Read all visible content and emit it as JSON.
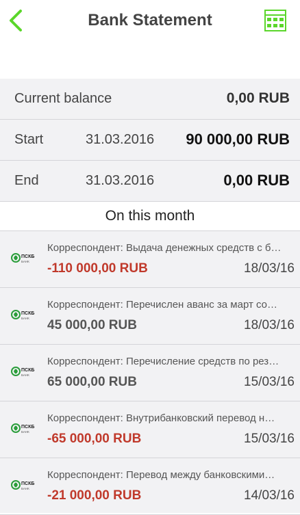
{
  "header": {
    "title": "Bank Statement"
  },
  "summary": [
    {
      "label": "Current balance",
      "date": "",
      "value": "0,00 RUB"
    },
    {
      "label": "Start",
      "date": "31.03.2016",
      "value": "90 000,00 RUB"
    },
    {
      "label": "End",
      "date": "31.03.2016",
      "value": "0,00 RUB"
    }
  ],
  "section": {
    "title": "On this month"
  },
  "logo": {
    "name": "ПСКБ",
    "sub": "БАНК"
  },
  "transactions": [
    {
      "desc": "Корреспондент:  Выдача денежных средств с б…",
      "amount": "-110 000,00 RUB",
      "date": "18/03/16",
      "negative": true
    },
    {
      "desc": "Корреспондент:  Перечислен аванс за март со…",
      "amount": "45 000,00 RUB",
      "date": "18/03/16",
      "negative": false
    },
    {
      "desc": "Корреспондент:  Перечисление средств по рез…",
      "amount": "65 000,00 RUB",
      "date": "15/03/16",
      "negative": false
    },
    {
      "desc": "Корреспондент:  Внутрибанковский перевод н…",
      "amount": "-65 000,00 RUB",
      "date": "15/03/16",
      "negative": true
    },
    {
      "desc": "Корреспондент:  Перевод между банковскими…",
      "amount": "-21 000,00 RUB",
      "date": "14/03/16",
      "negative": true
    }
  ],
  "colors": {
    "accent": "#5ad62a",
    "negative": "#c0392b"
  }
}
